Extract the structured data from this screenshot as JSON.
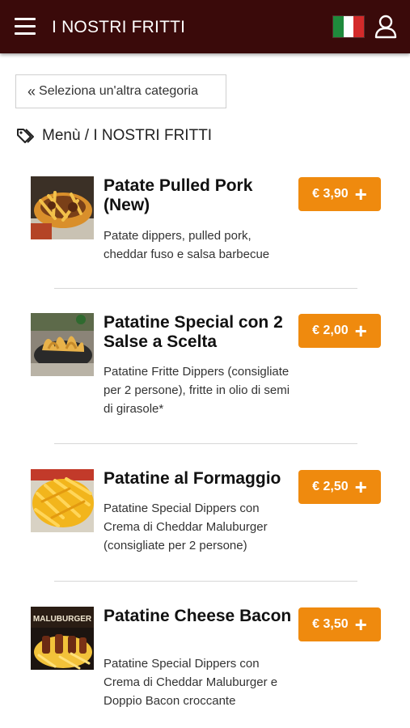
{
  "header": {
    "title": "I NOSTRI FRITTI",
    "menu_icon": "hamburger-icon",
    "language_icon": "italy-flag-icon",
    "user_icon": "user-icon"
  },
  "back_button": {
    "chevron": "«",
    "label": "Seleziona un'altra categoria"
  },
  "breadcrumb": {
    "icon": "tag-icon",
    "text": "Menù / I NOSTRI FRITTI"
  },
  "accent_color": "#ef8a0e",
  "header_color": "#3a0a0a",
  "products": [
    {
      "name": "Patate Pulled Pork (New)",
      "description": "Patate dippers, pulled pork, cheddar fuso e salsa barbecue",
      "price": "€ 3,90"
    },
    {
      "name": "Patatine Special con 2 Salse a Scelta",
      "description": "Patatine Fritte Dippers (consigliate per 2 persone), fritte in olio di semi di girasole*",
      "price": "€ 2,00"
    },
    {
      "name": "Patatine al Formaggio",
      "description": "Patatine Special Dippers con Crema di Cheddar Maluburger (consigliate per 2 persone)",
      "price": "€ 2,50"
    },
    {
      "name": "Patatine Cheese Bacon",
      "description": "Patatine Special Dippers con Crema di Cheddar Maluburger e Doppio Bacon croccante",
      "price": "€ 3,50",
      "image_text": "MALUBURGER"
    }
  ]
}
